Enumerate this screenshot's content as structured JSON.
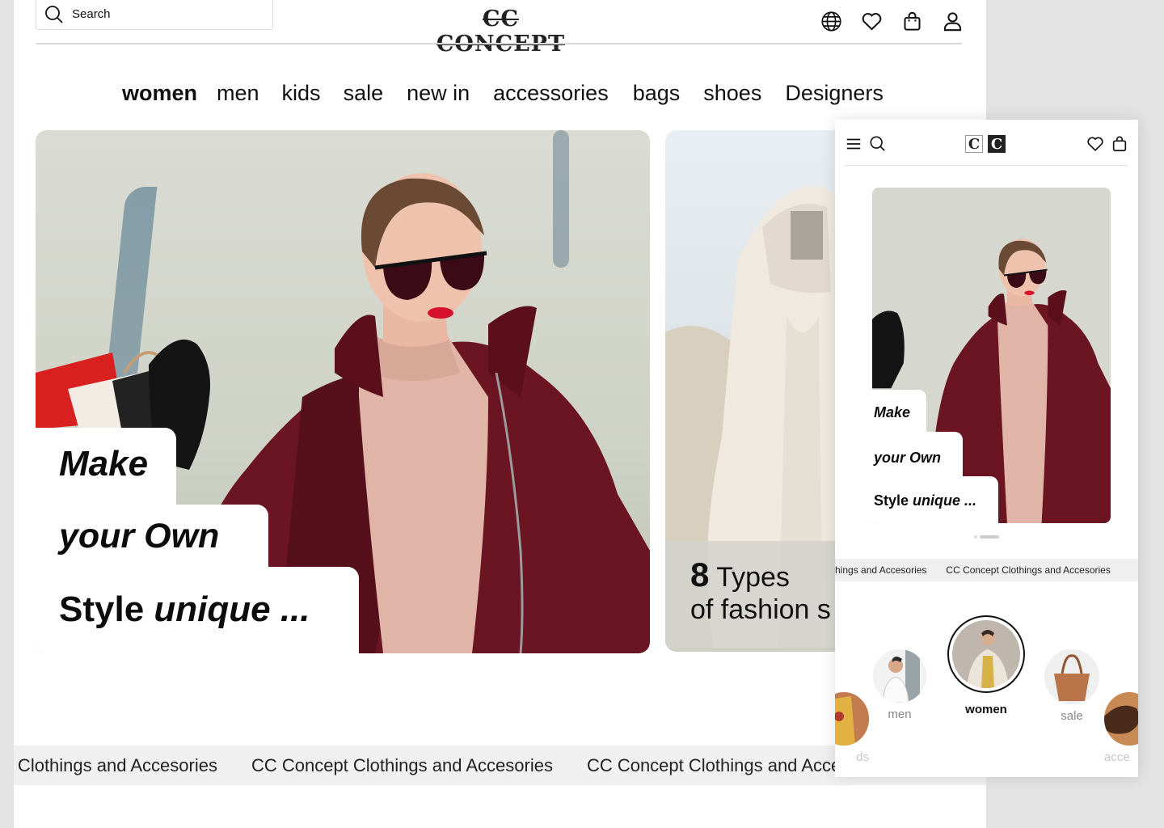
{
  "desktop": {
    "search": {
      "placeholder": "Search"
    },
    "logo": "CC CONCEPT",
    "header_icons": [
      "globe-icon",
      "heart-icon",
      "shopping-bag-icon",
      "user-icon"
    ],
    "nav": [
      "women",
      "men",
      "kids",
      "sale",
      "new in",
      "accessories",
      "bags",
      "shoes",
      "Designers"
    ],
    "active_nav": "women",
    "hero": {
      "line1": "Make",
      "line2": "your Own",
      "line3_bold": "Style",
      "line3_italic": "unique ..."
    },
    "second_card": {
      "number": "8",
      "line1": "Types",
      "line2": "of fashion s"
    },
    "marquee": [
      "ncept Clothings and Accesories",
      "CC Concept Clothings and Accesories",
      "CC Concept Clothings and Accesories"
    ]
  },
  "mobile": {
    "icons_left": [
      "menu-icon",
      "search-icon"
    ],
    "logo_letters": [
      "C",
      "C"
    ],
    "icons_right": [
      "heart-icon",
      "shopping-bag-icon"
    ],
    "hero": {
      "line1": "Make",
      "line2": "your Own",
      "line3_bold": "Style",
      "line3_italic": "unique ..."
    },
    "marquee": [
      "othings and Accesories",
      "CC Concept Clothings and Accesories"
    ],
    "categories": [
      {
        "label": "ds"
      },
      {
        "label": "men"
      },
      {
        "label": "women"
      },
      {
        "label": "sale"
      },
      {
        "label": "acce"
      }
    ]
  },
  "colors": {
    "coat": "#6b1422",
    "background": "#e3e3e3",
    "marquee_bg": "#f0f0f0"
  }
}
